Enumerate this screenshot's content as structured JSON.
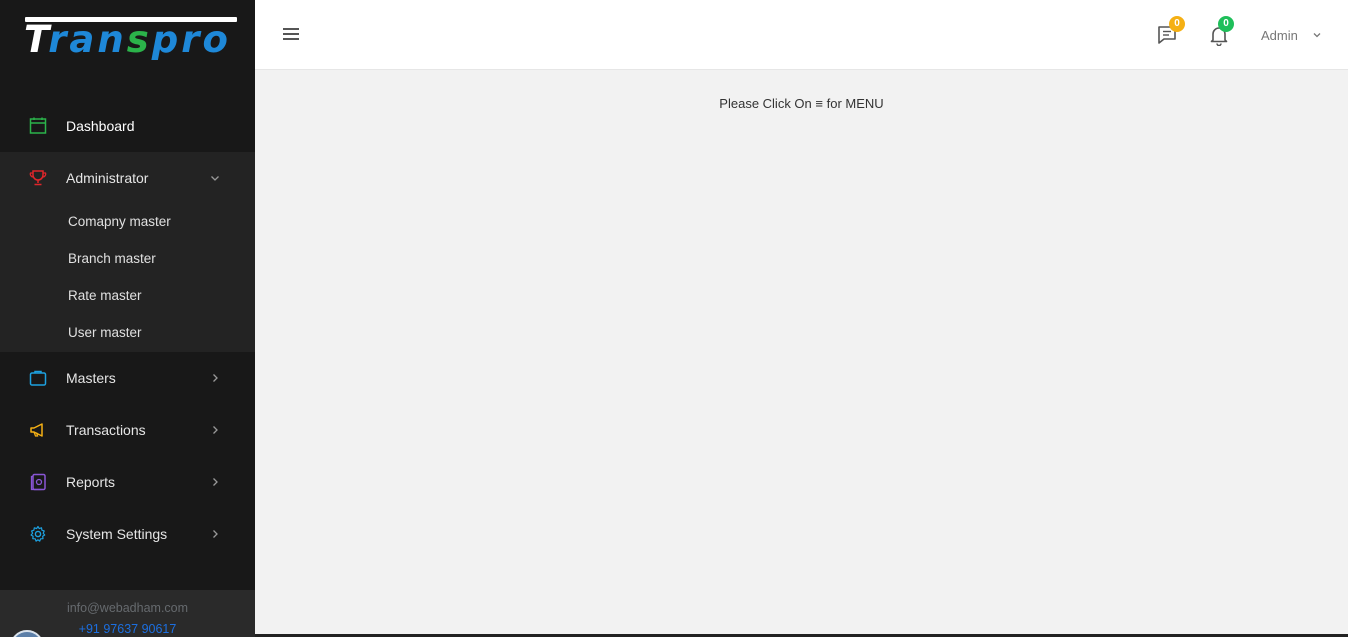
{
  "brand": {
    "logo_text_1": "T",
    "logo_text_2": "ran",
    "logo_text_3": "s",
    "logo_text_4": "pro"
  },
  "sidebar": {
    "dashboard": "Dashboard",
    "administrator": "Administrator",
    "admin_sub": [
      "Comapny master",
      "Branch master",
      "Rate master",
      "User master"
    ],
    "masters": "Masters",
    "transactions": "Transactions",
    "reports": "Reports",
    "system_settings": "System Settings",
    "footer_email": "info@webadham.com",
    "footer_phone": "+91 97637 90617"
  },
  "topbar": {
    "messages_count": "0",
    "notifications_count": "0",
    "user_name": "Admin"
  },
  "main": {
    "hint_before": "Please Click On",
    "hint_symbol": "≡",
    "hint_after": "for MENU"
  },
  "colors": {
    "sidebar_bg": "#181818",
    "admin_group_bg": "#232323",
    "dashboard_icon": "#2bb34a",
    "admin_icon": "#e0262b",
    "masters_icon": "#1da1e0",
    "transactions_icon": "#f5b014",
    "reports_icon": "#8a56d6",
    "settings_icon": "#1da1e0",
    "msg_badge": "#f5b014",
    "bell_badge": "#1fbf5a"
  }
}
